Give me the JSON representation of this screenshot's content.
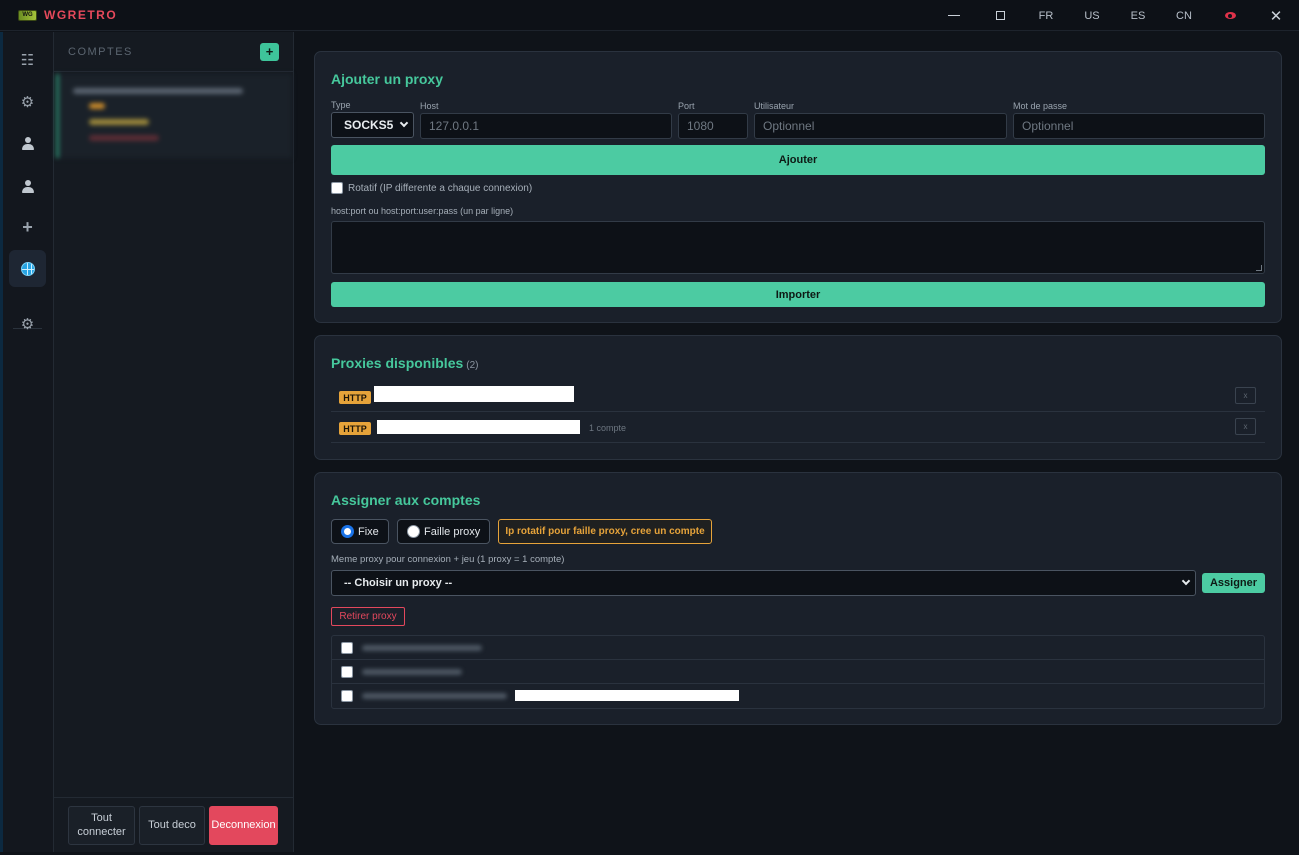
{
  "app": {
    "title": "WGRETRO",
    "logo_text": "WG"
  },
  "titlebar": {
    "languages": [
      "FR",
      "US",
      "ES",
      "CN"
    ]
  },
  "rail": {
    "items": [
      {
        "name": "list",
        "icon": "list-icon"
      },
      {
        "name": "settings",
        "icon": "gear-icon"
      },
      {
        "name": "account",
        "icon": "person-icon"
      },
      {
        "name": "accounts",
        "icon": "users-icon"
      },
      {
        "name": "add",
        "icon": "plus-icon"
      },
      {
        "name": "proxy",
        "icon": "globe-icon",
        "active": true
      },
      {
        "name": "options",
        "icon": "gear-icon"
      }
    ]
  },
  "accounts_panel": {
    "title": "COMPTES",
    "add_label": "+",
    "buttons": {
      "connect_all": "Tout connecter",
      "disconnect_all": "Tout deco",
      "logout": "Deconnexion"
    }
  },
  "add_proxy": {
    "title": "Ajouter un proxy",
    "type_label": "Type",
    "type_value": "SOCKS5",
    "host_label": "Host",
    "host_placeholder": "127.0.0.1",
    "port_label": "Port",
    "port_placeholder": "1080",
    "user_label": "Utilisateur",
    "user_placeholder": "Optionnel",
    "pass_label": "Mot de passe",
    "pass_placeholder": "Optionnel",
    "add_button": "Ajouter",
    "rotating_label": "Rotatif (IP differente a chaque connexion)",
    "import_label": "host:port ou host:port:user:pass (un par ligne)",
    "import_button": "Importer"
  },
  "proxies": {
    "title": "Proxies disponibles",
    "count": "(2)",
    "rows": [
      {
        "type": "HTTP",
        "note": "",
        "delete": "x"
      },
      {
        "type": "HTTP",
        "note": "1 compte",
        "delete": "x"
      }
    ]
  },
  "assign": {
    "title": "Assigner aux comptes",
    "mode_fixed": "Fixe",
    "mode_faille": "Faille proxy",
    "rotating_hint": "Ip rotatif pour faille proxy, cree un compte",
    "description": "Meme proxy pour connexion + jeu (1 proxy = 1 compte)",
    "select_value": "-- Choisir un proxy --",
    "assign_button": "Assigner",
    "remove_button": "Retirer proxy"
  },
  "colors": {
    "accent": "#4ccba2",
    "danger": "#e3485d",
    "warning": "#e6a33a",
    "brand": "#e6495b"
  }
}
